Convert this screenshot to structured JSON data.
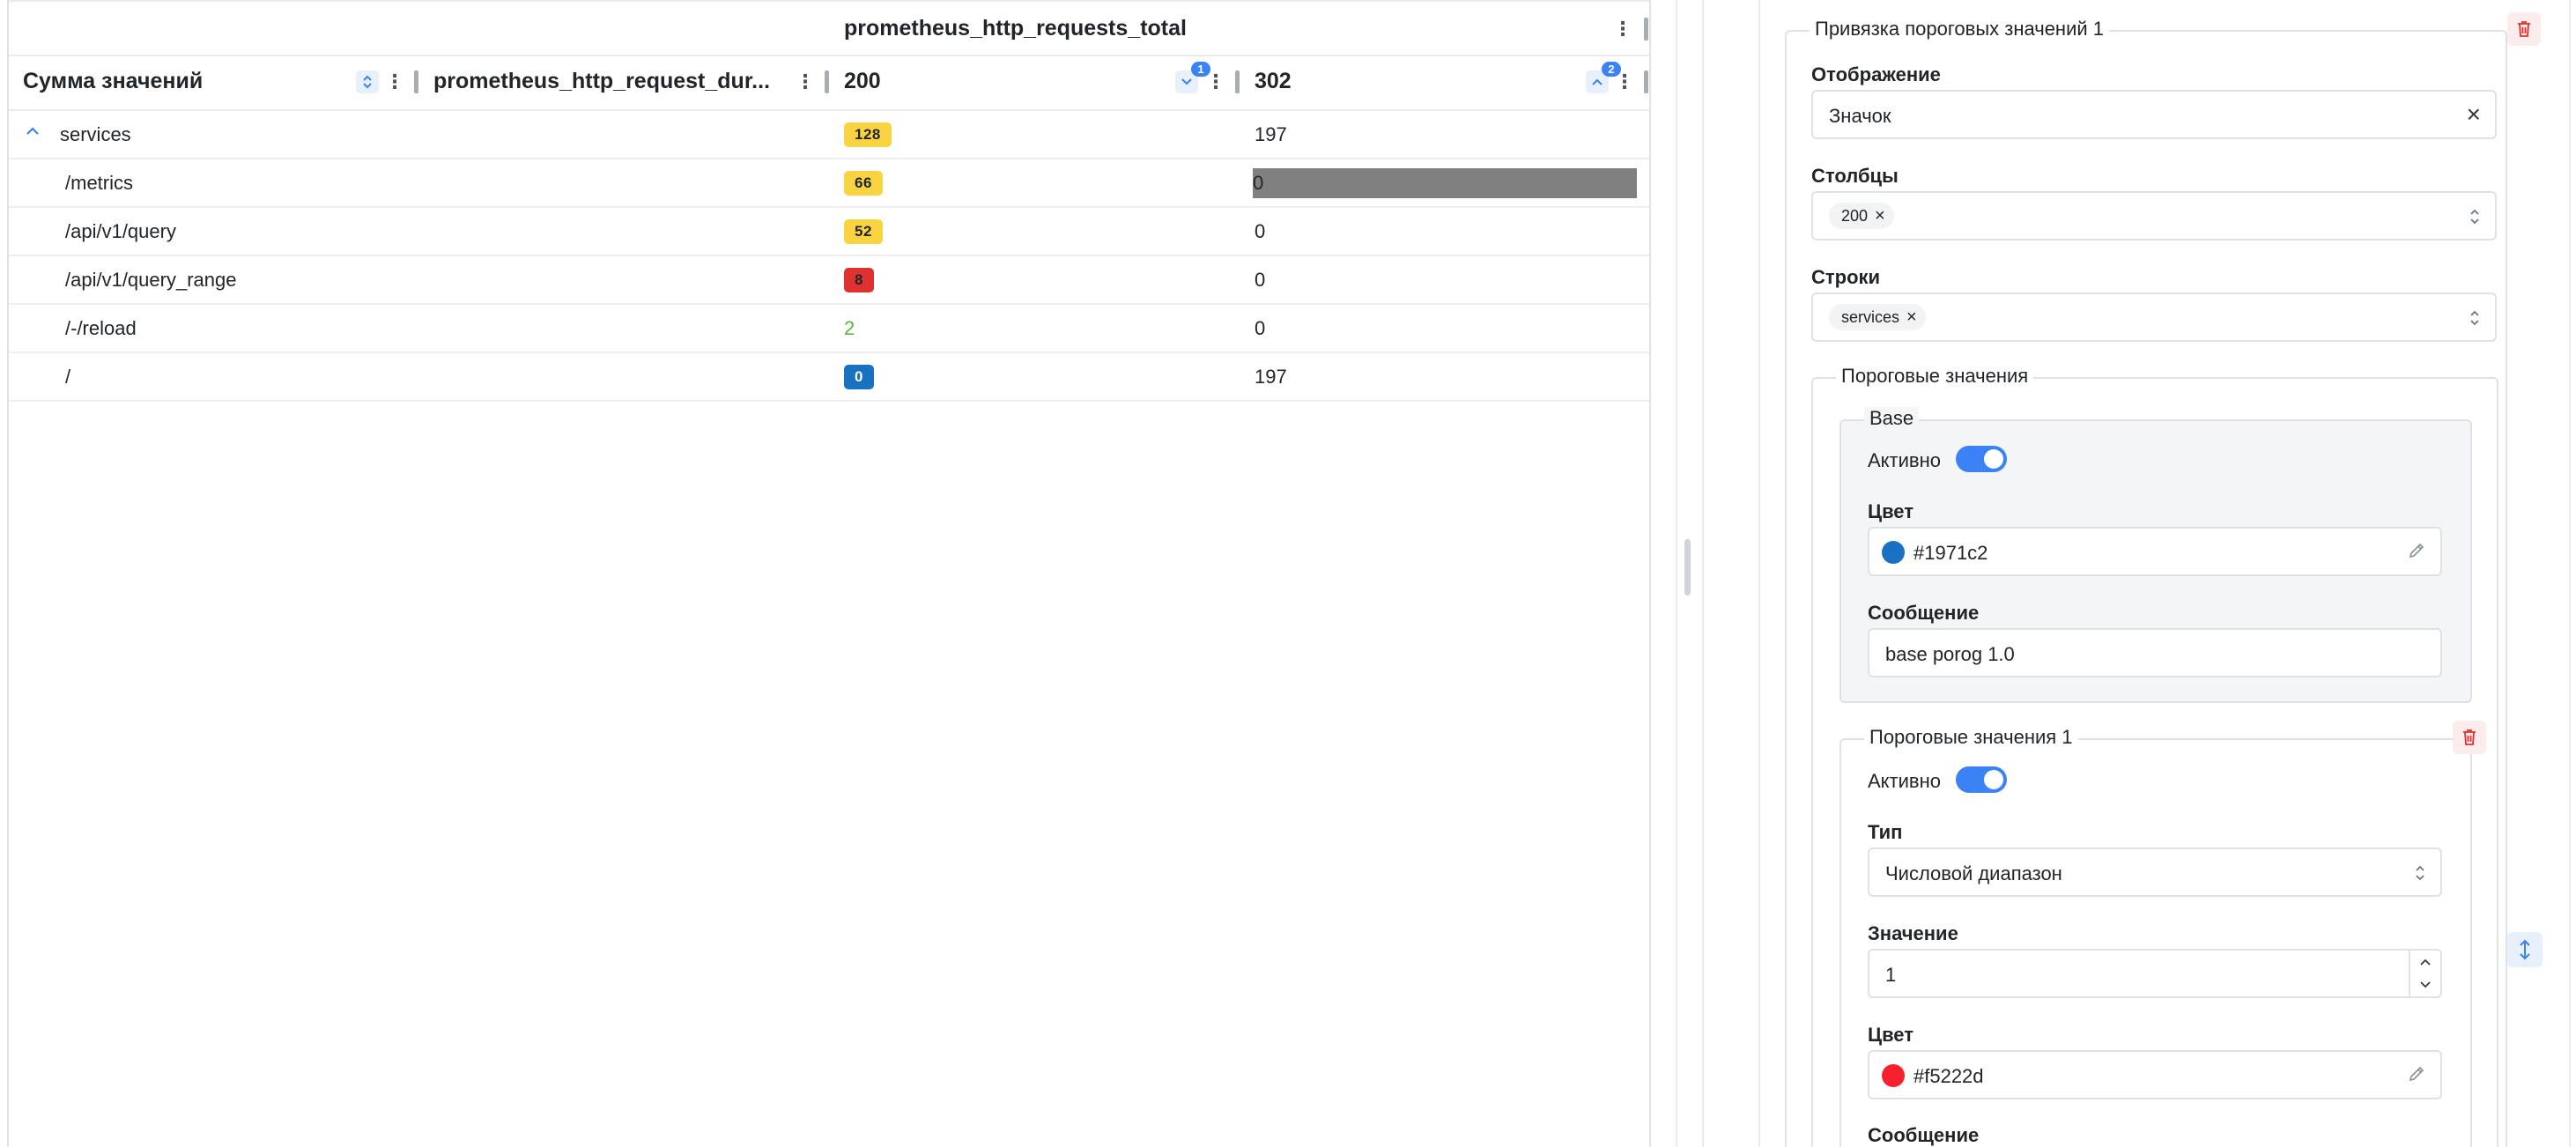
{
  "table": {
    "group_header": "prometheus_http_requests_total",
    "columns": [
      {
        "label": "Сумма значений"
      },
      {
        "label": "prometheus_http_request_dur..."
      },
      {
        "label": "200",
        "sort_badge": "1"
      },
      {
        "label": "302",
        "sort_badge": "2"
      }
    ],
    "rows": [
      {
        "name": "services",
        "v200": "128",
        "v302": "197"
      },
      {
        "name": "/metrics",
        "v200": "66",
        "v302": "0"
      },
      {
        "name": "/api/v1/query",
        "v200": "52",
        "v302": "0"
      },
      {
        "name": "/api/v1/query_range",
        "v200": "8",
        "v302": "0"
      },
      {
        "name": "/-/reload",
        "v200": "2",
        "v302": "0"
      },
      {
        "name": "/",
        "v200": "0",
        "v302": "197"
      }
    ]
  },
  "panel": {
    "binding_legend": "Привязка пороговых значений 1",
    "display_label": "Отображение",
    "display_value": "Значок",
    "columns_label": "Столбцы",
    "columns_chip": "200",
    "rows_label": "Строки",
    "rows_chip": "services",
    "thresholds_legend": "Пороговые значения",
    "base": {
      "legend": "Base",
      "active_label": "Активно",
      "color_label": "Цвет",
      "color_value": "#1971c2",
      "message_label": "Сообщение",
      "message_value": "base porog 1.0"
    },
    "threshold1": {
      "legend": "Пороговые значения 1",
      "active_label": "Активно",
      "type_label": "Тип",
      "type_value": "Числовой диапазон",
      "value_label": "Значение",
      "value_value": "1",
      "color_label": "Цвет",
      "color_value": "#f5222d",
      "message_label": "Сообщение"
    }
  },
  "colors": {
    "accent": "#3b82f6",
    "pill_yellow": "#fad440",
    "pill_red": "#e03131",
    "pill_blue": "#1971c2",
    "green": "#55b83c",
    "bar_gray": "#808080"
  }
}
